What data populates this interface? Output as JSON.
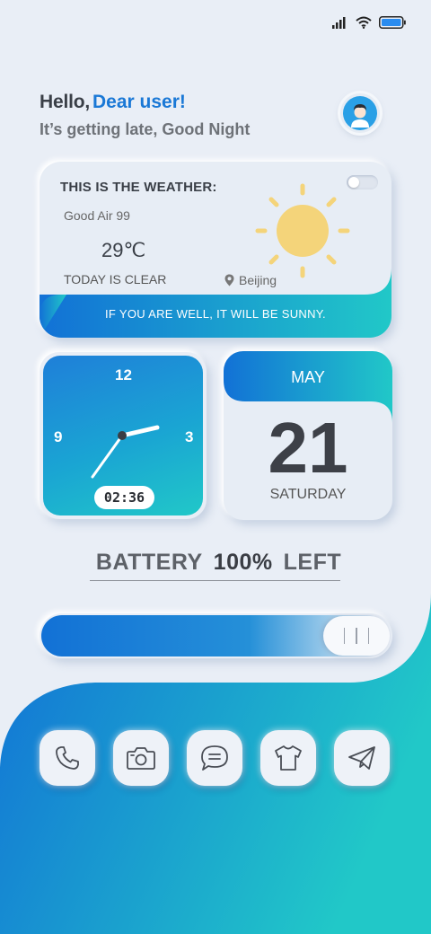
{
  "status_bar": {
    "signal_icon": "signal-bars-icon",
    "wifi_icon": "wifi-icon",
    "battery_icon": "battery-icon"
  },
  "greeting": {
    "hello": "Hello,",
    "user": "Dear user!",
    "subtitle": "It’s getting late, Good Night"
  },
  "weather": {
    "title": "THIS IS THE WEATHER:",
    "air": "Good Air 99",
    "temperature": "29℃",
    "condition": "TODAY IS CLEAR",
    "location": "Beijing",
    "banner": "IF YOU ARE WELL, IT WILL BE SUNNY.",
    "toggle_on": false
  },
  "clock": {
    "numerals": {
      "n12": "12",
      "n3": "3",
      "n9": "9"
    },
    "digital": "02:36"
  },
  "calendar": {
    "month": "MAY",
    "day": "21",
    "weekday": "SATURDAY"
  },
  "battery": {
    "label": "BATTERY",
    "percent": "100%",
    "suffix": "LEFT",
    "level": 1.0
  },
  "dock": {
    "apps": [
      "phone-icon",
      "camera-icon",
      "message-icon",
      "shirt-icon",
      "send-icon"
    ]
  },
  "colors": {
    "accent": "#1a78d6",
    "gradient_start": "#1271d6",
    "gradient_end": "#21c8c8",
    "background": "#e9eef6"
  }
}
